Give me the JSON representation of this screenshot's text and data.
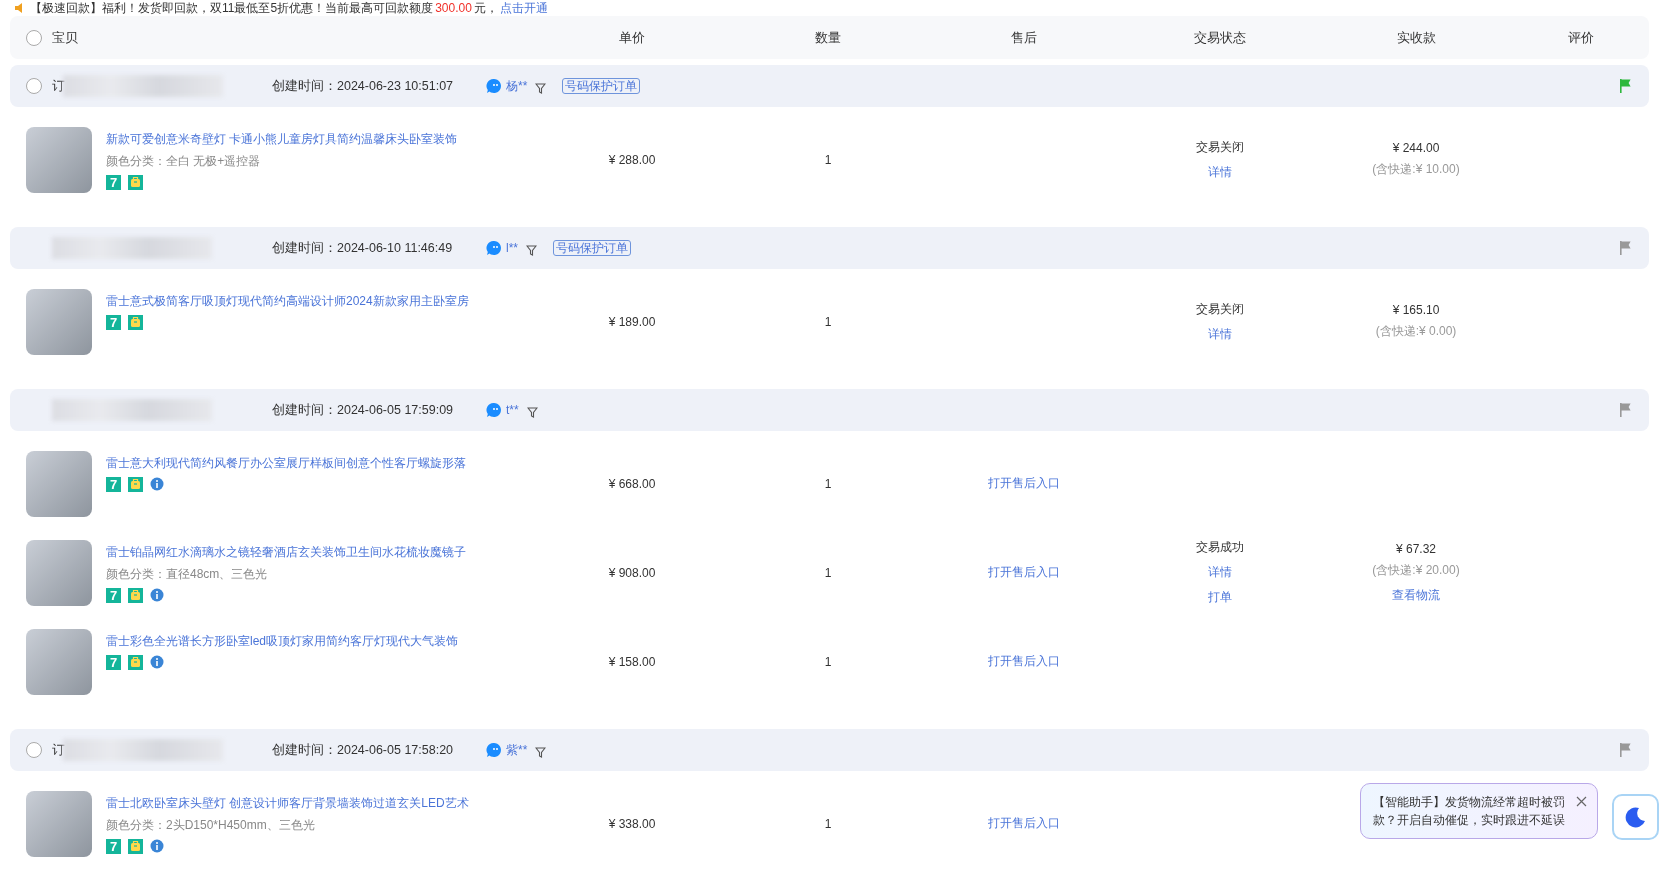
{
  "banner": {
    "text": "【极速回款】福利！发货即回款，双11最低至5折优惠！当前最高可回款额度",
    "amount": "300.00",
    "suffix": "元，",
    "link": "点击开通"
  },
  "header": {
    "checked": false,
    "columns": [
      "宝贝",
      "单价",
      "数量",
      "售后",
      "交易状态",
      "实收款",
      "评价"
    ]
  },
  "orders": [
    {
      "checked": false,
      "order_label": "订",
      "created": "创建时间：2024-06-23 10:51:07",
      "buyer": "杨**",
      "privacy_tag": "号码保护订单",
      "flagged": true,
      "status": {
        "text": "交易关闭",
        "actions": [
          "详情"
        ]
      },
      "received": {
        "amount": "¥ 244.00",
        "shipping": "(含快递:¥ 10.00)"
      },
      "items": [
        {
          "title": "新款可爱创意米奇壁灯 卡通小熊儿童房灯具简约温馨床头卧室装饰",
          "spec": "颜色分类：全白 无极+遥控器",
          "badges": [
            {
              "kind": "seven",
              "text": "7"
            },
            {
              "kind": "guarantee"
            }
          ],
          "price": "¥ 288.00",
          "qty": "1"
        }
      ]
    },
    {
      "created": "创建时间：2024-06-10 11:46:49",
      "buyer": "l**",
      "privacy_tag": "号码保护订单",
      "flagged": false,
      "status": {
        "text": "交易关闭",
        "actions": [
          "详情"
        ]
      },
      "received": {
        "amount": "¥ 165.10",
        "shipping": "(含快递:¥ 0.00)"
      },
      "items": [
        {
          "title": "雷士意式极简客厅吸顶灯现代简约高端设计师2024新款家用主卧室房",
          "badges": [
            {
              "kind": "seven",
              "text": "7"
            },
            {
              "kind": "guarantee"
            }
          ],
          "price": "¥ 189.00",
          "qty": "1"
        }
      ]
    },
    {
      "created": "创建时间：2024-06-05 17:59:09",
      "buyer": "t**",
      "flagged": false,
      "status": {
        "text": "交易成功",
        "actions": [
          "详情",
          "打单"
        ]
      },
      "received": {
        "amount": "¥ 67.32",
        "shipping": "(含快递:¥ 20.00)",
        "link": "查看物流"
      },
      "items": [
        {
          "title": "雷士意大利现代简约风餐厅办公室展厅样板间创意个性客厅螺旋形落",
          "badges": [
            {
              "kind": "seven",
              "text": "7"
            },
            {
              "kind": "guarantee"
            },
            {
              "kind": "info"
            }
          ],
          "price": "¥ 668.00",
          "qty": "1",
          "after_sale": "打开售后入口"
        },
        {
          "title": "雷士铂晶网红水滴璃水之镜轻奢酒店玄关装饰卫生间水花梳妆魔镜子",
          "spec": "颜色分类：直径48cm、三色光",
          "badges": [
            {
              "kind": "seven",
              "text": "7"
            },
            {
              "kind": "guarantee"
            },
            {
              "kind": "info"
            }
          ],
          "price": "¥ 908.00",
          "qty": "1",
          "after_sale": "打开售后入口"
        },
        {
          "title": "雷士彩色全光谱长方形卧室led吸顶灯家用简约客厅灯现代大气装饰",
          "badges": [
            {
              "kind": "seven",
              "text": "7"
            },
            {
              "kind": "guarantee"
            },
            {
              "kind": "info"
            }
          ],
          "price": "¥ 158.00",
          "qty": "1",
          "after_sale": "打开售后入口"
        }
      ]
    },
    {
      "checked": false,
      "order_label": "订",
      "created": "创建时间：2024-06-05 17:58:20",
      "buyer": "紫**",
      "flagged": false,
      "items": [
        {
          "title": "雷士北欧卧室床头壁灯 创意设计师客厅背景墙装饰过道玄关LED艺术",
          "spec": "颜色分类：2头D150*H450mm、三色光",
          "badges": [
            {
              "kind": "seven",
              "text": "7"
            },
            {
              "kind": "guarantee"
            },
            {
              "kind": "info"
            }
          ],
          "price": "¥ 338.00",
          "qty": "1",
          "after_sale": "打开售后入口"
        }
      ]
    }
  ],
  "assistant": {
    "text": "【智能助手】发货物流经常超时被罚款？开启自动催促，实时跟进不延误"
  }
}
